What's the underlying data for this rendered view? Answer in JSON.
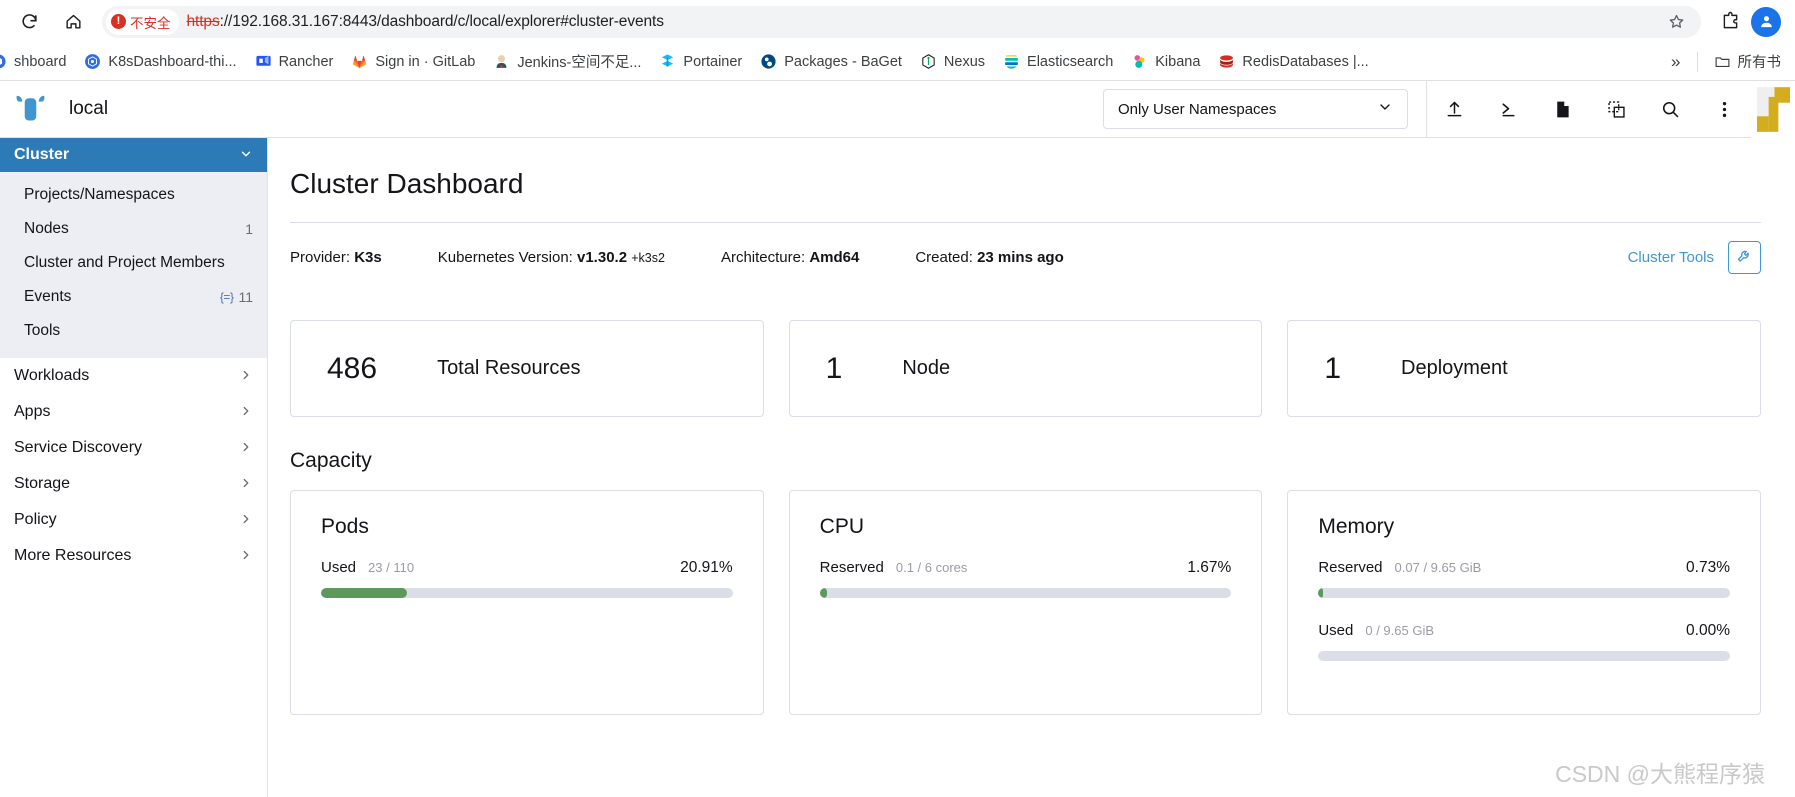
{
  "browser": {
    "nav": {
      "reload_icon": "reload-icon",
      "home_icon": "home-icon"
    },
    "security": {
      "badge_label": "不安全",
      "badge_icon": "not-secure-icon"
    },
    "url": {
      "scheme": "https",
      "rest": "://192.168.31.167:8443/dashboard/c/local/explorer#cluster-events"
    },
    "omni_actions": [
      {
        "name": "bookmark-star-icon",
        "glyph": "star"
      },
      {
        "name": "extensions-icon",
        "glyph": "puzzle"
      },
      {
        "name": "profile-avatar",
        "glyph": "person"
      }
    ],
    "bookmarks": [
      {
        "label": "shboard",
        "icon": "k8s-dashboard-icon",
        "color": "#326ce5",
        "shape": "circle"
      },
      {
        "label": "K8sDashboard-thi...",
        "icon": "k8s-dashboard-icon",
        "color": "#326ce5",
        "shape": "k8s"
      },
      {
        "label": "Rancher",
        "icon": "rancher-icon",
        "color": "#2453ff",
        "shape": "rancher"
      },
      {
        "label": "Sign in · GitLab",
        "icon": "gitlab-icon",
        "color": "#fc6d26",
        "shape": "gitlab"
      },
      {
        "label": "Jenkins-空间不足...",
        "icon": "jenkins-icon",
        "color": "#d33833",
        "shape": "jenkins"
      },
      {
        "label": "Portainer",
        "icon": "portainer-icon",
        "color": "#13bef9",
        "shape": "portainer"
      },
      {
        "label": "Packages - BaGet",
        "icon": "baget-icon",
        "color": "#004880",
        "shape": "baget"
      },
      {
        "label": "Nexus",
        "icon": "nexus-icon",
        "color": "#1b1c1d",
        "shape": "nexus"
      },
      {
        "label": "Elasticsearch",
        "icon": "elasticsearch-icon",
        "color": "#00bfb3",
        "shape": "elastic"
      },
      {
        "label": "Kibana",
        "icon": "kibana-icon",
        "color": "#e8488b",
        "shape": "kibana"
      },
      {
        "label": "RedisDatabases |...",
        "icon": "redis-icon",
        "color": "#d82c20",
        "shape": "redis"
      }
    ],
    "bookmarks_overflow_label": "»",
    "all_bookmarks_label": "所有书"
  },
  "app": {
    "header": {
      "cluster_name": "local",
      "logo_icon": "rancher-cow-logo",
      "namespace_filter": {
        "value": "Only User Namespaces",
        "chevron_icon": "chevron-down-icon"
      },
      "actions": [
        {
          "name": "import-yaml-icon",
          "title": "Import YAML"
        },
        {
          "name": "kubectl-shell-icon",
          "title": "Kubectl Shell"
        },
        {
          "name": "docs-file-icon",
          "title": "Docs"
        },
        {
          "name": "cluster-explorer-icon",
          "title": "Cluster Explorer"
        },
        {
          "name": "search-icon",
          "title": "Search"
        },
        {
          "name": "kebab-menu-icon",
          "title": "More"
        }
      ],
      "account_logo": "user-avatar-logo"
    },
    "sidebar": {
      "group": {
        "label": "Cluster",
        "expanded": true,
        "chevron_icon": "chevron-down-icon"
      },
      "cluster_items": [
        {
          "label": "Projects/Namespaces",
          "count": ""
        },
        {
          "label": "Nodes",
          "count": "1"
        },
        {
          "label": "Cluster and Project Members",
          "count": ""
        },
        {
          "label": "Events",
          "count": "11",
          "glyph": "{=}"
        },
        {
          "label": "Tools",
          "count": ""
        }
      ],
      "groups": [
        {
          "label": "Workloads",
          "chevron_icon": "chevron-right-icon"
        },
        {
          "label": "Apps",
          "chevron_icon": "chevron-right-icon"
        },
        {
          "label": "Service Discovery",
          "chevron_icon": "chevron-right-icon"
        },
        {
          "label": "Storage",
          "chevron_icon": "chevron-right-icon"
        },
        {
          "label": "Policy",
          "chevron_icon": "chevron-right-icon"
        },
        {
          "label": "More Resources",
          "chevron_icon": "chevron-right-icon"
        }
      ]
    },
    "main": {
      "page_title": "Cluster Dashboard",
      "meta": [
        {
          "label": "Provider:",
          "value": "K3s",
          "sub": ""
        },
        {
          "label": "Kubernetes Version:",
          "value": "v1.30.2",
          "sub": "+k3s2"
        },
        {
          "label": "Architecture:",
          "value": "Amd64",
          "sub": ""
        },
        {
          "label": "Created:",
          "value": "23 mins ago",
          "sub": ""
        }
      ],
      "cluster_tools_label": "Cluster Tools",
      "cluster_tools_icon": "wrench-icon",
      "counts": [
        {
          "number": "486",
          "label": "Total Resources"
        },
        {
          "number": "1",
          "label": "Node"
        },
        {
          "number": "1",
          "label": "Deployment"
        }
      ],
      "capacity_title": "Capacity",
      "capacity": [
        {
          "title": "Pods",
          "gauges": [
            {
              "label": "Used",
              "detail": "23 / 110",
              "percent": "20.91%",
              "fill": 20.91,
              "color": "#5d995d"
            }
          ]
        },
        {
          "title": "CPU",
          "gauges": [
            {
              "label": "Reserved",
              "detail": "0.1 / 6 cores",
              "percent": "1.67%",
              "fill": 1.67,
              "color": "#5d995d"
            }
          ]
        },
        {
          "title": "Memory",
          "gauges": [
            {
              "label": "Reserved",
              "detail": "0.07 / 9.65 GiB",
              "percent": "0.73%",
              "fill": 0.73,
              "color": "#5d995d"
            },
            {
              "label": "Used",
              "detail": "0 / 9.65 GiB",
              "percent": "0.00%",
              "fill": 0,
              "color": "#5d995d"
            }
          ]
        }
      ]
    }
  },
  "watermark": "CSDN @大熊程序猿",
  "colors": {
    "accent": "#2d7bb6",
    "link": "#3d98d3",
    "bar_fill": "#5d995d",
    "danger": "#d93025"
  }
}
